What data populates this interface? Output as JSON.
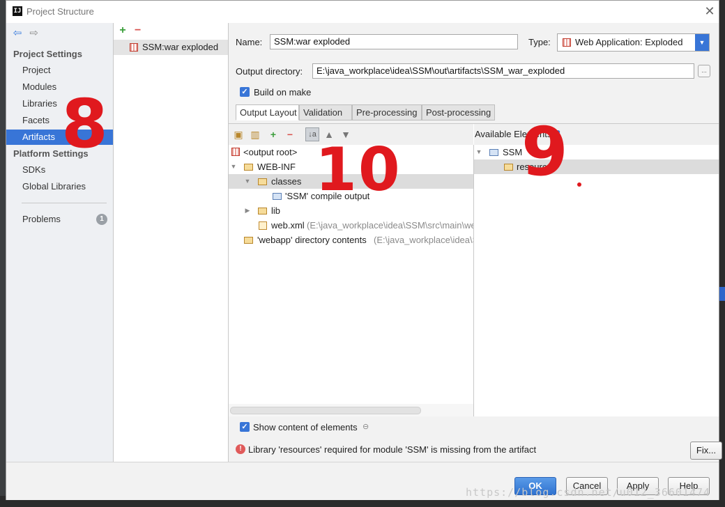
{
  "window": {
    "title": "Project Structure",
    "close_glyph": "✕"
  },
  "nav": {
    "back_glyph": "⇦",
    "forward_glyph": "⇨",
    "project_settings_header": "Project Settings",
    "project_settings_items": [
      "Project",
      "Modules",
      "Libraries",
      "Facets",
      "Artifacts"
    ],
    "selected_item": "Artifacts",
    "platform_settings_header": "Platform Settings",
    "platform_settings_items": [
      "SDKs",
      "Global Libraries"
    ],
    "problems_label": "Problems",
    "problems_count": "1"
  },
  "artifacts": {
    "add_glyph": "+",
    "remove_glyph": "−",
    "items": [
      "SSM:war exploded"
    ]
  },
  "form": {
    "name_label": "Name:",
    "name_value": "SSM:war exploded",
    "type_label": "Type:",
    "type_value": "Web Application: Exploded",
    "output_dir_label": "Output directory:",
    "output_dir_value": "E:\\java_workplace\\idea\\SSM\\out\\artifacts\\SSM_war_exploded",
    "browse_glyph": "...",
    "build_on_make_label": "Build on make",
    "build_on_make_checked": true
  },
  "tabs": [
    "Output Layout",
    "Validation",
    "Pre-processing",
    "Post-processing"
  ],
  "active_tab": "Output Layout",
  "layout_tree": {
    "output_root": "<output root>",
    "web_inf": "WEB-INF",
    "classes": "classes",
    "compile_output": "'SSM' compile output",
    "lib": "lib",
    "web_xml": "web.xml",
    "web_xml_path": "(E:\\java_workplace\\idea\\SSM\\src\\main\\we",
    "webapp_contents": "'webapp' directory contents",
    "webapp_path": "(E:\\java_workplace\\idea\\S"
  },
  "available": {
    "label": "Available Elements",
    "help_glyph": "?",
    "module": "SSM",
    "resources": "resources"
  },
  "bottom": {
    "show_content_label": "Show content of elements",
    "show_content_checked": true,
    "warning_text": "Library 'resources' required for module 'SSM' is missing from the artifact",
    "fix_label": "Fix..."
  },
  "buttons": {
    "ok": "OK",
    "cancel": "Cancel",
    "apply": "Apply",
    "help": "Help"
  },
  "annotations": {
    "eight": "8",
    "ten": "10",
    "nine": "9"
  },
  "watermark": "https://blog.csdn.net/u012_36601474"
}
